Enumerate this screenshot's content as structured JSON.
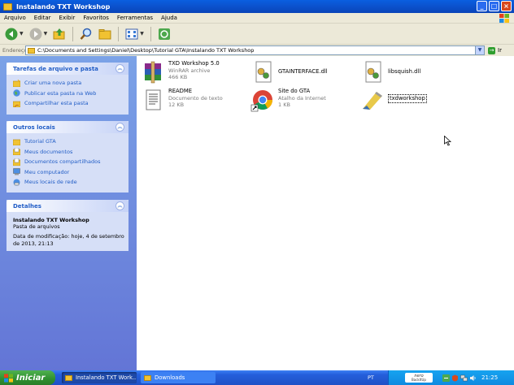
{
  "window": {
    "title": "Instalando TXT Workshop"
  },
  "menu": [
    "Arquivo",
    "Editar",
    "Exibir",
    "Favoritos",
    "Ferramentas",
    "Ajuda"
  ],
  "address": {
    "label": "Endereço",
    "path": "C:\\Documents and Settings\\Daniel\\Desktop\\Tutorial GTA\\Instalando TXT Workshop",
    "go_label": "Ir"
  },
  "tasks_panel": {
    "title": "Tarefas de arquivo e pasta",
    "items": [
      "Criar uma nova pasta",
      "Publicar esta pasta na Web",
      "Compartilhar esta pasta"
    ]
  },
  "places_panel": {
    "title": "Outros locais",
    "items": [
      "Tutorial GTA",
      "Meus documentos",
      "Documentos compartilhados",
      "Meu computador",
      "Meus locais de rede"
    ]
  },
  "details_panel": {
    "title": "Detalhes",
    "name": "Instalando TXT Workshop",
    "type": "Pasta de arquivos",
    "modified_line1": "Data de modificação: hoje, 4 de setembro",
    "modified_line2": "de 2013, 21:13"
  },
  "files": [
    {
      "name": "TXD Workshop 5.0",
      "type": "WinRAR archive",
      "size": "466 KB",
      "icon": "winrar-icon"
    },
    {
      "name": "GTAINTERFACE.dll",
      "type": "",
      "size": "",
      "icon": "dll-icon"
    },
    {
      "name": "libsquish.dll",
      "type": "",
      "size": "",
      "icon": "dll-icon"
    },
    {
      "name": "README",
      "type": "Documento de texto",
      "size": "12 KB",
      "icon": "text-document-icon"
    },
    {
      "name": "Site do GTA",
      "type": "Atalho da Internet",
      "size": "1 KB",
      "icon": "chrome-shortcut-icon"
    },
    {
      "name": "txdworkshop",
      "type": "",
      "size": "",
      "icon": "txdworkshop-app-icon"
    }
  ],
  "taskbar": {
    "start_label": "Iniciar",
    "buttons": [
      "Instalando TXT Work...",
      "Downloads"
    ],
    "language": "PT",
    "nero_top": "nero",
    "nero_bottom": "BackItUp",
    "clock": "21:25"
  },
  "colors": {
    "titlebar": "#0a54d0",
    "taskpane": "#6f8fe0",
    "link": "#215dc6",
    "start": "#2f8f2f"
  }
}
